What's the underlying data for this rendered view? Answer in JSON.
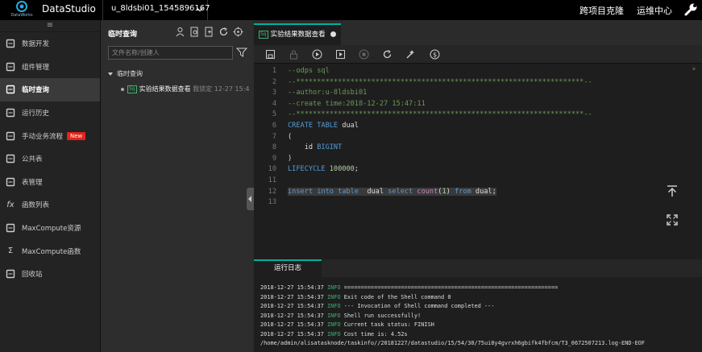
{
  "topbar": {
    "logo_text": "DataWorks",
    "app_title": "DataStudio",
    "project": "u_8ldsbi01_1545896167",
    "cross_project_clone": "跨项目克隆",
    "ops_center": "运维中心"
  },
  "sidebar": {
    "collapse_glyph": "≡",
    "items": [
      {
        "label": "数据开发",
        "icon": "code-icon"
      },
      {
        "label": "组件管理",
        "icon": "puzzle-icon"
      },
      {
        "label": "临时查询",
        "icon": "search-icon"
      },
      {
        "label": "运行历史",
        "icon": "clock-icon"
      },
      {
        "label": "手动业务流程",
        "icon": "workflow-icon",
        "badge": "New"
      },
      {
        "label": "公共表",
        "icon": "table-icon"
      },
      {
        "label": "表管理",
        "icon": "table-manage-icon"
      },
      {
        "label": "函数列表",
        "icon": "function-icon",
        "glyph": "fx"
      },
      {
        "label": "MaxCompute资源",
        "icon": "resource-icon"
      },
      {
        "label": "MaxCompute函数",
        "icon": "sigma-icon",
        "glyph": "Σ"
      },
      {
        "label": "回收站",
        "icon": "trash-icon"
      }
    ],
    "active_index": 2
  },
  "panel": {
    "title": "临时查询",
    "search_placeholder": "文件名称/创建人",
    "tree_root": "临时查询",
    "node": {
      "badge": "Sq",
      "name": "实验结果数据查看",
      "lock": "我锁定",
      "time": "12-27 15:4"
    }
  },
  "editor_tab": {
    "badge": "Sq",
    "title": "实验结果数据查看"
  },
  "code_lines": [
    {
      "n": "1",
      "parts": [
        {
          "t": "--odps sql",
          "c": "c-com"
        }
      ]
    },
    {
      "n": "2",
      "parts": [
        {
          "t": "--*********************************************************************--",
          "c": "c-com"
        }
      ]
    },
    {
      "n": "3",
      "parts": [
        {
          "t": "--author:u-8ldsbi01",
          "c": "c-com"
        }
      ]
    },
    {
      "n": "4",
      "parts": [
        {
          "t": "--create time:2018-12-27 15:47:11",
          "c": "c-com"
        }
      ]
    },
    {
      "n": "5",
      "parts": [
        {
          "t": "--*********************************************************************--",
          "c": "c-com"
        }
      ]
    },
    {
      "n": "6",
      "parts": [
        {
          "t": "CREATE TABLE ",
          "c": "c-kw"
        },
        {
          "t": "dual",
          "c": "c-id"
        }
      ]
    },
    {
      "n": "7",
      "parts": [
        {
          "t": "(",
          "c": "c-id"
        }
      ]
    },
    {
      "n": "8",
      "parts": [
        {
          "t": "    id ",
          "c": "c-id"
        },
        {
          "t": "BIGINT",
          "c": "c-kw"
        }
      ]
    },
    {
      "n": "9",
      "parts": [
        {
          "t": ")",
          "c": "c-id"
        }
      ]
    },
    {
      "n": "10",
      "parts": [
        {
          "t": "LIFECYCLE ",
          "c": "c-kw"
        },
        {
          "t": "100000",
          "c": "c-num"
        },
        {
          "t": ";",
          "c": "c-id"
        }
      ]
    },
    {
      "n": "11",
      "parts": []
    },
    {
      "n": "12",
      "hl": true,
      "parts": [
        {
          "t": "insert into table ",
          "c": "c-kw"
        },
        {
          "t": " dual ",
          "c": "c-id"
        },
        {
          "t": "select ",
          "c": "c-kw"
        },
        {
          "t": "count",
          "c": "c-fn"
        },
        {
          "t": "(",
          "c": "c-id"
        },
        {
          "t": "1",
          "c": "c-num"
        },
        {
          "t": ") ",
          "c": "c-id"
        },
        {
          "t": "from ",
          "c": "c-kw"
        },
        {
          "t": "dual;",
          "c": "c-id"
        }
      ]
    },
    {
      "n": "13",
      "parts": []
    }
  ],
  "log_tab": "运行日志",
  "log_lines": [
    {
      "ts": "2018-12-27 15:54:37 ",
      "lvl": "INFO",
      "msg": " ================================================================"
    },
    {
      "ts": "2018-12-27 15:54:37 ",
      "lvl": "INFO",
      "msg": " Exit code of the Shell command 0"
    },
    {
      "ts": "2018-12-27 15:54:37 ",
      "lvl": "INFO",
      "msg": " --- Invocation of Shell command completed ---"
    },
    {
      "ts": "2018-12-27 15:54:37 ",
      "lvl": "INFO",
      "msg": " Shell run successfully!"
    },
    {
      "ts": "2018-12-27 15:54:37 ",
      "lvl": "INFO",
      "msg": " Current task status: FINISH"
    },
    {
      "ts": "2018-12-27 15:54:37 ",
      "lvl": "INFO",
      "msg": " Cost time is: 4.52s"
    },
    {
      "ts": "",
      "lvl": "",
      "msg": "/home/admin/alisatasknode/taskinfo//20181227/datastudio/15/54/30/75ui8y4gvrxh6gbifk4fbfcm/T3_0672507213.log-END-EOF"
    }
  ],
  "colors": {
    "accent": "#00b0a0",
    "new_badge": "#e2231a",
    "info": "#3cb371"
  }
}
